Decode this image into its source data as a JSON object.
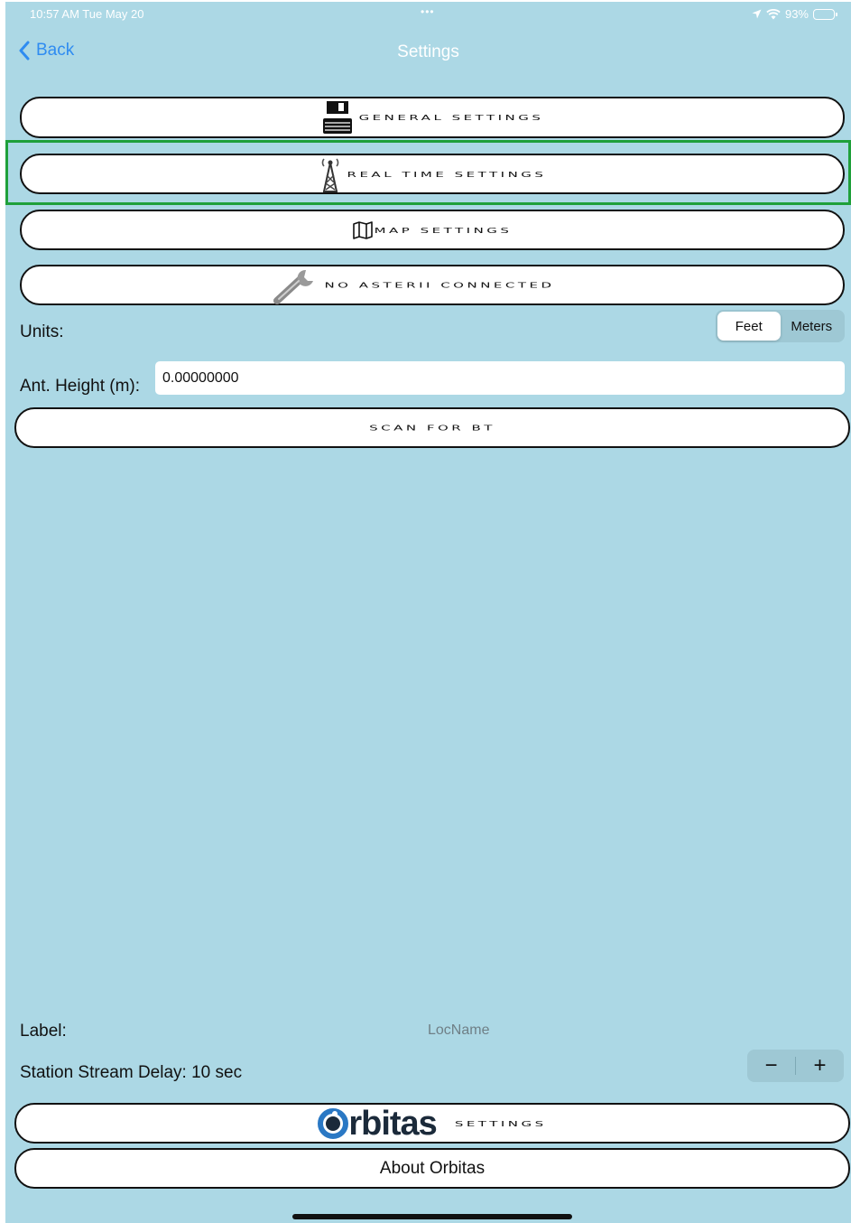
{
  "status_bar": {
    "time": "10:57 AM  Tue May 20",
    "dots": "•••",
    "battery": "93%"
  },
  "nav": {
    "back_label": "Back",
    "title": "Settings"
  },
  "buttons": {
    "general": "General Settings",
    "realtime": "Real Time Settings",
    "map": "Map Settings",
    "asterii": "No Asterii Connected",
    "scan": "Scan For BT",
    "orbitas_settings": "Settings",
    "about": "About Orbitas"
  },
  "units": {
    "label": "Units:",
    "options": [
      "Feet",
      "Meters"
    ],
    "selected": "Feet"
  },
  "antenna": {
    "label": "Ant. Height (m):",
    "value": "0.00000000"
  },
  "location": {
    "label": "Label:",
    "placeholder": "LocName"
  },
  "stream_delay": {
    "label": "Station Stream Delay: 10 sec",
    "minus": "−",
    "plus": "+"
  },
  "logo": {
    "text": "rbitas"
  },
  "colors": {
    "background": "#acd8e5",
    "accent_blue": "#2f8cf1",
    "highlight_green": "#1fa03a"
  }
}
